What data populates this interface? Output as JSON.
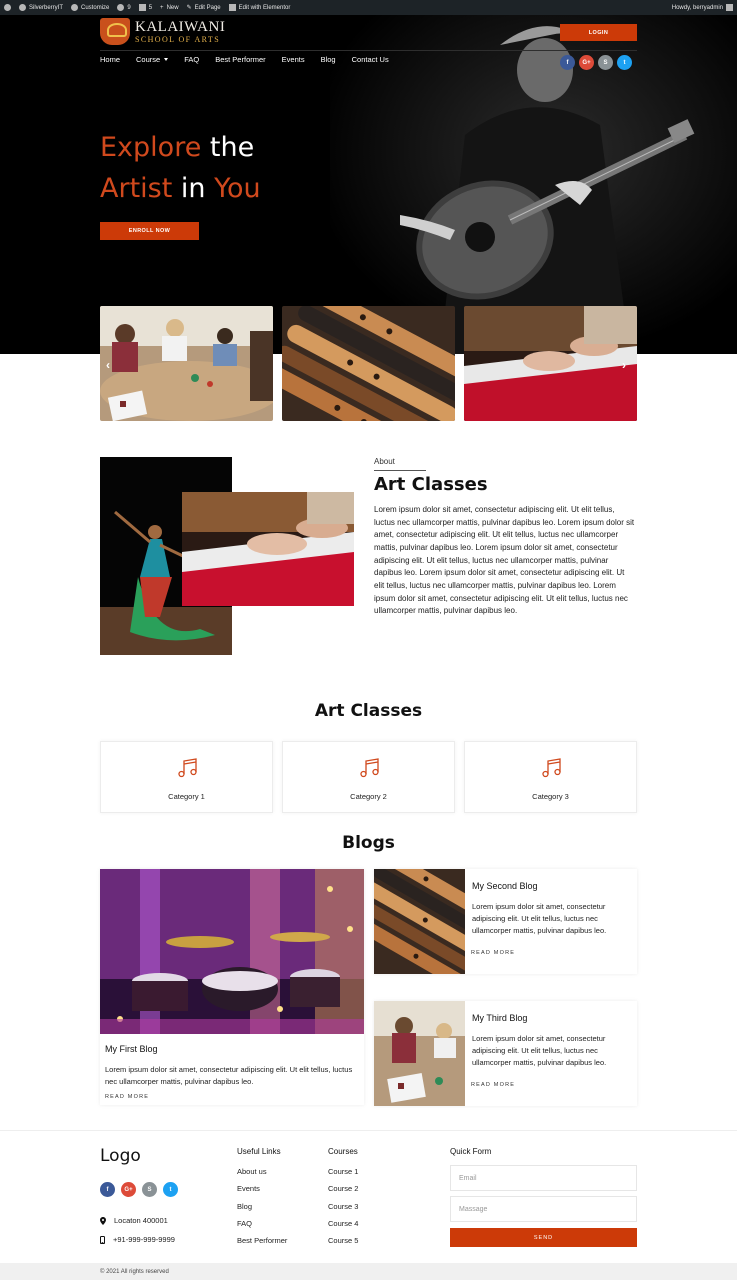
{
  "admin_bar": {
    "site": "SilverberryIT",
    "customize": "Customize",
    "updates": "9",
    "comments": "5",
    "new": "New",
    "edit_page": "Edit Page",
    "edit_elementor": "Edit with Elementor",
    "howdy": "Howdy, berryadmin"
  },
  "header": {
    "logo_main": "KALAIWANI",
    "logo_sub": "SCHOOL OF ARTS",
    "login": "LOGIN",
    "nav": [
      "Home",
      "Course",
      "FAQ",
      "Best Performer",
      "Events",
      "Blog",
      "Contact Us"
    ],
    "social": [
      "f",
      "G+",
      "S",
      "t"
    ]
  },
  "hero": {
    "line1_a": "Explore",
    "line1_b": "the",
    "line2_a": "Artist",
    "line2_b": "in",
    "line2_c": "You",
    "enroll": "ENROLL NOW"
  },
  "slider": {
    "prev": "‹",
    "next": "›",
    "slides": [
      "children-crafts-photo",
      "flutes-photo",
      "piano-photo"
    ]
  },
  "about": {
    "eyebrow": "About",
    "title": "Art Classes",
    "text": "Lorem ipsum dolor sit amet, consectetur adipiscing elit. Ut elit tellus, luctus nec ullamcorper mattis, pulvinar dapibus leo. Lorem ipsum dolor sit amet, consectetur adipiscing elit. Ut elit tellus, luctus nec ullamcorper mattis, pulvinar dapibus leo. Lorem ipsum dolor sit amet, consectetur adipiscing elit. Ut elit tellus, luctus nec ullamcorper mattis, pulvinar dapibus leo. Lorem ipsum dolor sit amet, consectetur adipiscing elit. Ut elit tellus, luctus nec ullamcorper mattis, pulvinar dapibus leo. Lorem ipsum dolor sit amet, consectetur adipiscing elit. Ut elit tellus, luctus nec ullamcorper mattis, pulvinar dapibus leo."
  },
  "art_classes": {
    "title": "Art Classes",
    "categories": [
      "Category 1",
      "Category 2",
      "Category 3"
    ]
  },
  "blogs": {
    "title": "Blogs",
    "read_more": "READ MORE",
    "items": [
      {
        "title": "My First Blog",
        "text": "Lorem ipsum dolor sit amet, consectetur adipiscing elit. Ut elit tellus, luctus nec ullamcorper mattis, pulvinar dapibus leo."
      },
      {
        "title": "My Second Blog",
        "text": "Lorem ipsum dolor sit amet, consectetur adipiscing elit. Ut elit tellus, luctus nec ullamcorper mattis, pulvinar dapibus leo."
      },
      {
        "title": "My Third Blog",
        "text": "Lorem ipsum dolor sit amet, consectetur adipiscing elit. Ut elit tellus, luctus nec ullamcorper mattis, pulvinar dapibus leo."
      }
    ]
  },
  "footer": {
    "logo": "Logo",
    "location": "Locaton 400001",
    "phone": "+91-999-999-9999",
    "useful_links_title": "Useful Links",
    "useful_links": [
      "About us",
      "Events",
      "Blog",
      "FAQ",
      "Best Performer"
    ],
    "courses_title": "Courses",
    "courses": [
      "Course 1",
      "Course 2",
      "Course 3",
      "Course 4",
      "Course 5"
    ],
    "form_title": "Quick Form",
    "email_placeholder": "Email",
    "message_placeholder": "Massage",
    "send": "SEND",
    "copyright": "© 2021 All rights reserved"
  },
  "colors": {
    "accent": "#cc3a08",
    "dark": "#000000"
  }
}
